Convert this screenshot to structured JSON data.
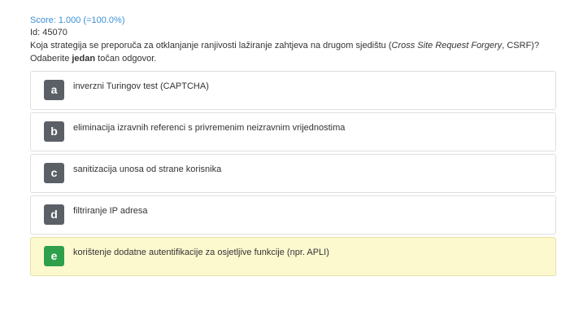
{
  "header": {
    "score": "Score: 1.000 (=100.0%)",
    "id": "Id: 45070"
  },
  "question": {
    "part1": "Koja strategija se preporuča za otklanjanje ranjivosti lažiranje zahtjeva na drugom sjedištu (",
    "italic": "Cross Site Request Forgery",
    "part2": ", CSRF)? Odaberite ",
    "bold": "jedan",
    "part3": " točan odgovor."
  },
  "answers": [
    {
      "letter": "a",
      "text": "inverzni Turingov test (CAPTCHA)",
      "correct": false
    },
    {
      "letter": "b",
      "text": "eliminacija izravnih referenci s privremenim neizravnim vrijednostima",
      "correct": false
    },
    {
      "letter": "c",
      "text": "sanitizacija unosa od strane korisnika",
      "correct": false
    },
    {
      "letter": "d",
      "text": "filtriranje IP adresa",
      "correct": false
    },
    {
      "letter": "e",
      "text": "korištenje dodatne autentifikacije za osjetljive funkcije (npr. APLI)",
      "correct": true
    }
  ],
  "colors": {
    "score": "#3a8fd6",
    "letter_badge": "#5b6066",
    "correct_badge": "#2e9f4a",
    "correct_background": "#fdf9cf"
  }
}
